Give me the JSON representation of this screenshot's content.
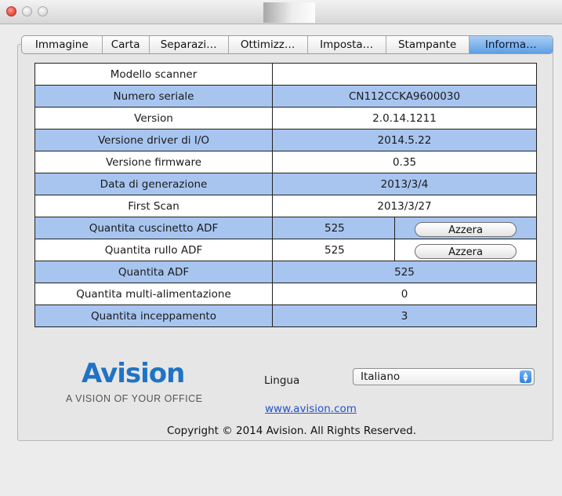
{
  "window": {
    "title": ""
  },
  "tabs": [
    {
      "label": "Immagine",
      "active": false
    },
    {
      "label": "Carta",
      "active": false
    },
    {
      "label": "Separazi…",
      "active": false
    },
    {
      "label": "Ottimizz…",
      "active": false
    },
    {
      "label": "Imposta…",
      "active": false
    },
    {
      "label": "Stampante",
      "active": false
    },
    {
      "label": "Informa…",
      "active": true
    }
  ],
  "info": {
    "rows": [
      {
        "label": "Modello scanner",
        "value": ""
      },
      {
        "label": "Numero seriale",
        "value": "CN112CCKA9600030"
      },
      {
        "label": "Version",
        "value": "2.0.14.1211"
      },
      {
        "label": "Versione driver di I/O",
        "value": "2014.5.22"
      },
      {
        "label": "Versione firmware",
        "value": "0.35"
      },
      {
        "label": "Data di generazione",
        "value": "2013/3/4"
      },
      {
        "label": "First Scan",
        "value": "2013/3/27"
      },
      {
        "label": "Quantita cuscinetto ADF",
        "value": "525",
        "button": "Azzera"
      },
      {
        "label": "Quantita rullo ADF",
        "value": "525",
        "button": "Azzera"
      },
      {
        "label": "Quantita ADF",
        "value": "525"
      },
      {
        "label": "Quantita multi-alimentazione",
        "value": "0"
      },
      {
        "label": "Quantita inceppamento",
        "value": "3"
      }
    ]
  },
  "footer": {
    "logo_text": "Avision",
    "tagline": "A VISION OF YOUR OFFICE",
    "language_label": "Lingua",
    "language_selected": "Italiano",
    "website": "www.avision.com",
    "copyright": "Copyright © 2014 Avision. All Rights Reserved."
  },
  "colors": {
    "row_alt": "#a8c5f0",
    "tab_active": "#5f9fe4",
    "logo": "#1f73c4",
    "link": "#2352c6"
  }
}
